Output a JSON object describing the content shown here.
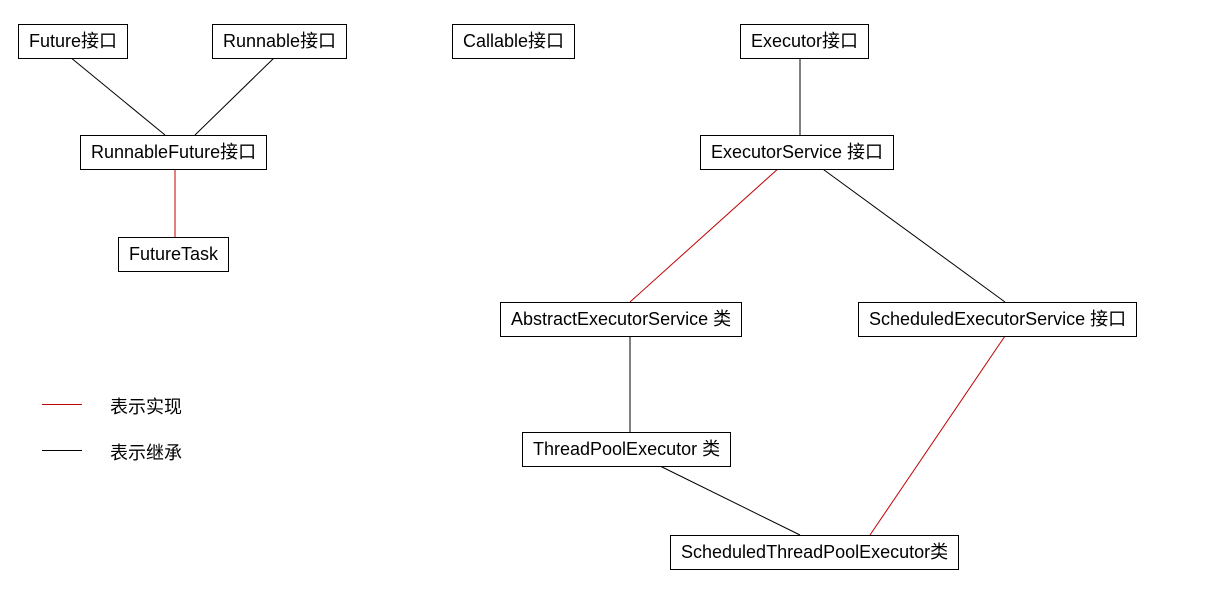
{
  "nodes": {
    "future": "Future接口",
    "runnable": "Runnable接口",
    "callable": "Callable接口",
    "executor": "Executor接口",
    "runnableFuture": "RunnableFuture接口",
    "futureTask": "FutureTask",
    "executorService": "ExecutorService 接口",
    "abstractExecutorService": "AbstractExecutorService 类",
    "scheduledExecutorService": "ScheduledExecutorService 接口",
    "threadPoolExecutor": "ThreadPoolExecutor 类",
    "scheduledThreadPoolExecutor": "ScheduledThreadPoolExecutor类"
  },
  "legend": {
    "implements": "表示实现",
    "extends": "表示继承"
  },
  "colors": {
    "implements": "#c00000",
    "extends": "#000000"
  },
  "edges": [
    {
      "from": "future",
      "to": "runnableFuture",
      "type": "extends"
    },
    {
      "from": "runnable",
      "to": "runnableFuture",
      "type": "extends"
    },
    {
      "from": "runnableFuture",
      "to": "futureTask",
      "type": "implements"
    },
    {
      "from": "executor",
      "to": "executorService",
      "type": "extends"
    },
    {
      "from": "executorService",
      "to": "abstractExecutorService",
      "type": "implements"
    },
    {
      "from": "executorService",
      "to": "scheduledExecutorService",
      "type": "extends"
    },
    {
      "from": "abstractExecutorService",
      "to": "threadPoolExecutor",
      "type": "extends"
    },
    {
      "from": "threadPoolExecutor",
      "to": "scheduledThreadPoolExecutor",
      "type": "extends"
    },
    {
      "from": "scheduledExecutorService",
      "to": "scheduledThreadPoolExecutor",
      "type": "implements"
    }
  ]
}
